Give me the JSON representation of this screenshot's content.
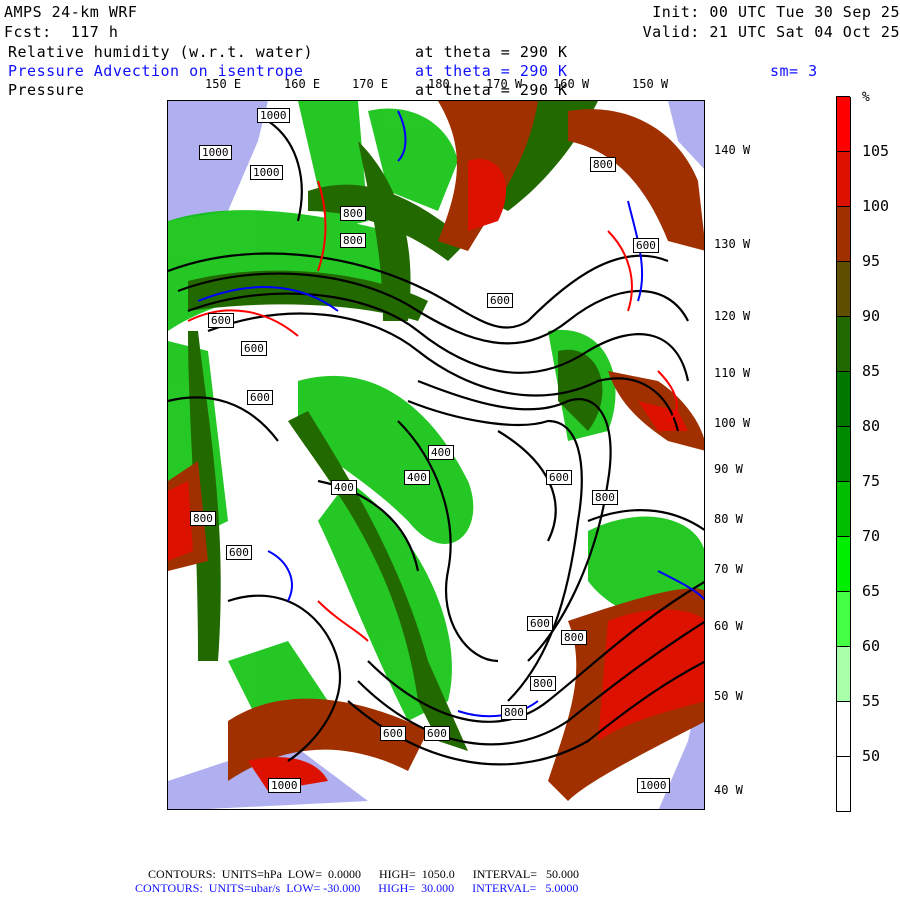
{
  "header": {
    "model": "AMPS 24-km WRF",
    "forecast": "Fcst:  117 h",
    "init": "Init: 00 UTC Tue 30 Sep 25",
    "valid": "Valid: 21 UTC Sat 04 Oct 25",
    "field1": "Relative humidity (w.r.t. water)",
    "field1_level": "at theta = 290 K",
    "field2": "Pressure Advection on isentrope",
    "field2_level": "at theta = 290 K",
    "smoothing": "sm= 3",
    "field3": "Pressure",
    "field3_level": "at theta = 290 K"
  },
  "lon_top": [
    "150 E",
    "160 E",
    "170 E",
    "180",
    "170 W",
    "160 W",
    "150 W"
  ],
  "lon_right": [
    "140 W",
    "130 W",
    "120 W",
    "110 W",
    "100 W",
    "90 W",
    "80 W",
    "70 W",
    "60 W",
    "50 W",
    "40 W"
  ],
  "contour_labels": [
    "1000",
    "1000",
    "1000",
    "800",
    "800",
    "800",
    "600",
    "600",
    "600",
    "600",
    "600",
    "400",
    "400",
    "400",
    "600",
    "800",
    "800",
    "600",
    "600",
    "800",
    "800",
    "800",
    "600",
    "600",
    "1000",
    "1000"
  ],
  "colorbar": {
    "unit": "%",
    "colors": [
      "#ff0000",
      "#dd1100",
      "#a03000",
      "#604f00",
      "#226a00",
      "#007800",
      "#008a00",
      "#00be00",
      "#00ee00",
      "#44ff44",
      "#aaffaa",
      "#ffffff",
      "#ffffff"
    ],
    "labels": [
      "105",
      "100",
      "95",
      "90",
      "85",
      "80",
      "75",
      "70",
      "65",
      "60",
      "55",
      "50"
    ]
  },
  "footer": {
    "line1": "CONTOURS:  UNITS=hPa  LOW=  0.0000      HIGH=  1050.0      INTERVAL=   50.000",
    "line2": "CONTOURS:  UNITS=ubar/s  LOW= -30.000      HIGH=  30.000      INTERVAL=   5.0000"
  },
  "colors": {
    "land_mask": "#b0b0f0",
    "pos_advection": "#ff0000",
    "neg_advection": "#0000ff",
    "pressure": "#000000"
  }
}
